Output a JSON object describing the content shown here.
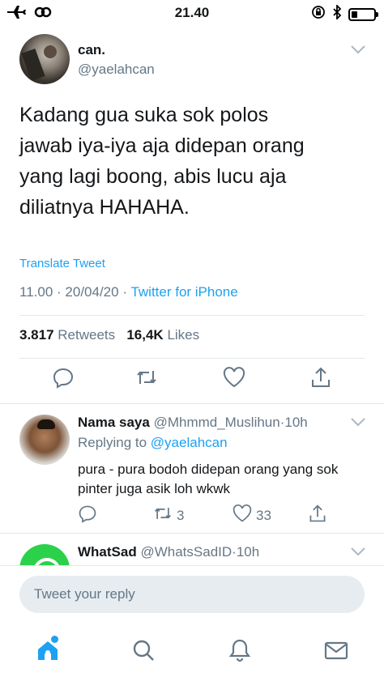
{
  "status_bar": {
    "time": "21.40",
    "battery_level": 0.25
  },
  "main_tweet": {
    "name": "can.",
    "handle": "@yaelahcan",
    "text_lines": [
      "Kadang gua suka sok polos",
      "jawab iya-iya aja didepan orang",
      "yang lagi boong, abis lucu aja",
      "diliatnya HAHAHA."
    ],
    "translate_label": "Translate Tweet",
    "time": "11.00",
    "separator": "·",
    "date": "20/04/20",
    "source": "Twitter for iPhone",
    "retweets_count": "3.817",
    "retweets_label": "Retweets",
    "likes_count": "16,4K",
    "likes_label": "Likes"
  },
  "replies": [
    {
      "name": "Nama saya",
      "handle": "@Mhmmd_Muslihun",
      "separator": "·",
      "time": "10h",
      "replying_label": "Replying to",
      "replying_to": "@yaelahcan",
      "text": "pura - pura bodoh didepan orang yang sok pinter juga asik loh wkwk",
      "retweets": "3",
      "likes": "33"
    },
    {
      "name": "WhatSad",
      "handle": "@WhatsSadID",
      "separator": "·",
      "time": "10h"
    }
  ],
  "compose": {
    "placeholder": "Tweet your reply"
  },
  "colors": {
    "accent": "#1da1f2",
    "secondary_text": "#657786",
    "primary_text": "#14171a"
  },
  "icons": [
    "airplane-icon",
    "hotspot-icon",
    "lock-rotation-icon",
    "bluetooth-icon",
    "battery-icon",
    "chevron-down-icon",
    "reply-icon",
    "retweet-icon",
    "like-icon",
    "share-icon",
    "home-icon",
    "search-icon",
    "notifications-icon",
    "messages-icon"
  ]
}
